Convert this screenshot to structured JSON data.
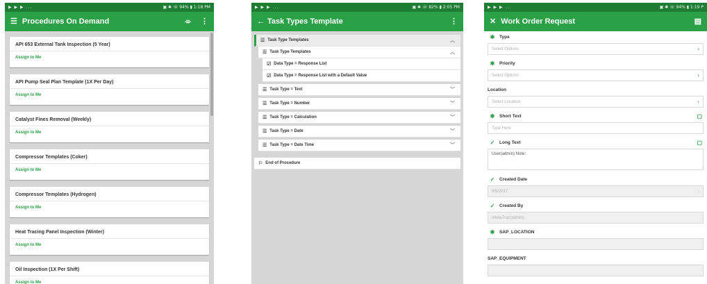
{
  "screen1": {
    "status": {
      "left": "▶ ▶ ▶ ...",
      "right": "▣ ✱ ☏ 94% ▮ 1:18 PM"
    },
    "title": "Procedures On Demand",
    "cards": [
      {
        "title": "API 653 External Tank Inspection (5 Year)",
        "action": "Assign to Me"
      },
      {
        "title": "API Pump Seal Plan Template (1X Per Day)",
        "action": "Assign to Me"
      },
      {
        "title": "Catalyst Fines Removal (Weekly)",
        "action": "Assign to Me"
      },
      {
        "title": "Compressor Templates (Coker)",
        "action": "Assign to Me"
      },
      {
        "title": "Compressor Templates (Hydrogen)",
        "action": "Assign to Me"
      },
      {
        "title": "Heat Tracing Panel Inspection (Winter)",
        "action": "Assign to Me"
      },
      {
        "title": "Oil Inspection (1X Per Shift)",
        "action": "Assign to Me"
      }
    ]
  },
  "screen2": {
    "status": {
      "left": "▶ ▶ ▶ ...",
      "right": "▣ ✱ ☏ 82% ▮ 2:05 PM"
    },
    "title": "Task Types Template",
    "rows": [
      "Task Type Templates",
      "Task Type Templates",
      "Data Type = Response List",
      "Data Type = Response List with a Default Value",
      "Task Type = Text",
      "Task Type = Number",
      "Task Type = Calculation",
      "Task Type = Date",
      "Task Type = Date Time",
      "End of Procedure"
    ]
  },
  "screen3": {
    "status": {
      "left": "▶ ▶ ▶ ...",
      "right": "▣ ✱ ☏ 94% ▮ 1:19 P"
    },
    "title": "Work Order Request",
    "fields": [
      {
        "label": "Type",
        "value": "Select Options"
      },
      {
        "label": "Priority",
        "value": "Select Options"
      },
      {
        "label": "Location",
        "value": "Select Location"
      },
      {
        "label": "Short Text",
        "value": "Type Here"
      },
      {
        "label": "Long Text",
        "value": "User(admin) Note:"
      },
      {
        "label": "Created Date",
        "value": "9/5/2017"
      },
      {
        "label": "Created By",
        "value": "IntelaTrac(admin)"
      },
      {
        "label": "SAP_LOCATION",
        "value": ""
      },
      {
        "label": "SAP_EQUIPMENT",
        "value": ""
      }
    ]
  },
  "colors": {
    "accent": "#2aa146",
    "statusbar": "#1e7c33",
    "background": "#d6d6d6"
  }
}
